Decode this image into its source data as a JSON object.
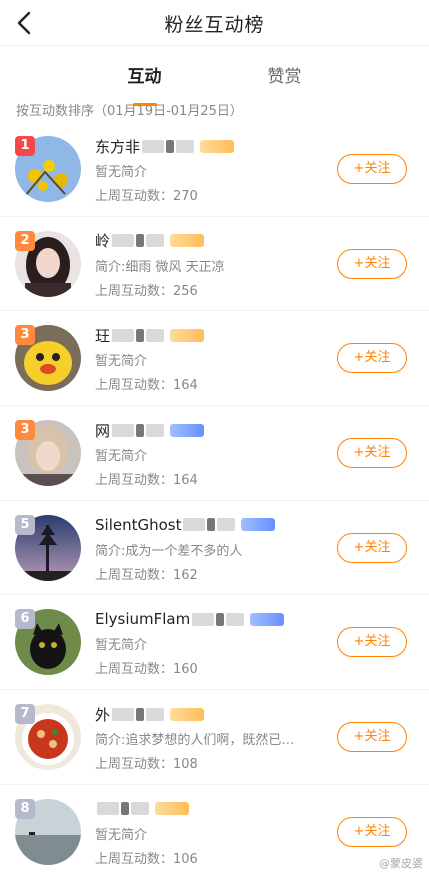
{
  "header": {
    "title": "粉丝互动榜"
  },
  "tabs": [
    {
      "label": "互动"
    },
    {
      "label": "赞赏"
    }
  ],
  "sort_note": "按互动数排序（01月19日-01月25日）",
  "follow_label": "+关注",
  "count_prefix": "上周互动数：",
  "colors": {
    "accent": "#ff8200",
    "rank_top": "#f74848",
    "rank_mid": "#ff8a3d",
    "rank_rest": "#b6b9cc"
  },
  "fans": [
    {
      "rank": "1",
      "nick": "东方非",
      "intro": "暂无简介",
      "count": "270",
      "avatar": "yellow-flowers"
    },
    {
      "rank": "2",
      "nick": "岭",
      "intro": "简介:细雨 微风 天正凉",
      "count": "256",
      "avatar": "girl-portrait"
    },
    {
      "rank": "3",
      "nick": "玨",
      "intro": "暂无简介",
      "count": "164",
      "avatar": "yellow-doll"
    },
    {
      "rank": "3",
      "nick": "网",
      "intro": "暂无简介",
      "count": "164",
      "avatar": "girl-selfie"
    },
    {
      "rank": "5",
      "nick": "SilentGhost",
      "intro": "简介:成为一个差不多的人",
      "count": "162",
      "avatar": "tree-sky"
    },
    {
      "rank": "6",
      "nick": "ElysiumFlam",
      "intro": "暂无简介",
      "count": "160",
      "avatar": "black-cat"
    },
    {
      "rank": "7",
      "nick": "外",
      "intro": "简介:追求梦想的人们啊，既然已…",
      "count": "108",
      "avatar": "food-plate"
    },
    {
      "rank": "8",
      "nick": "",
      "intro": "暂无简介",
      "count": "106",
      "avatar": "lake"
    }
  ],
  "watermark": "@蒙皮婆"
}
